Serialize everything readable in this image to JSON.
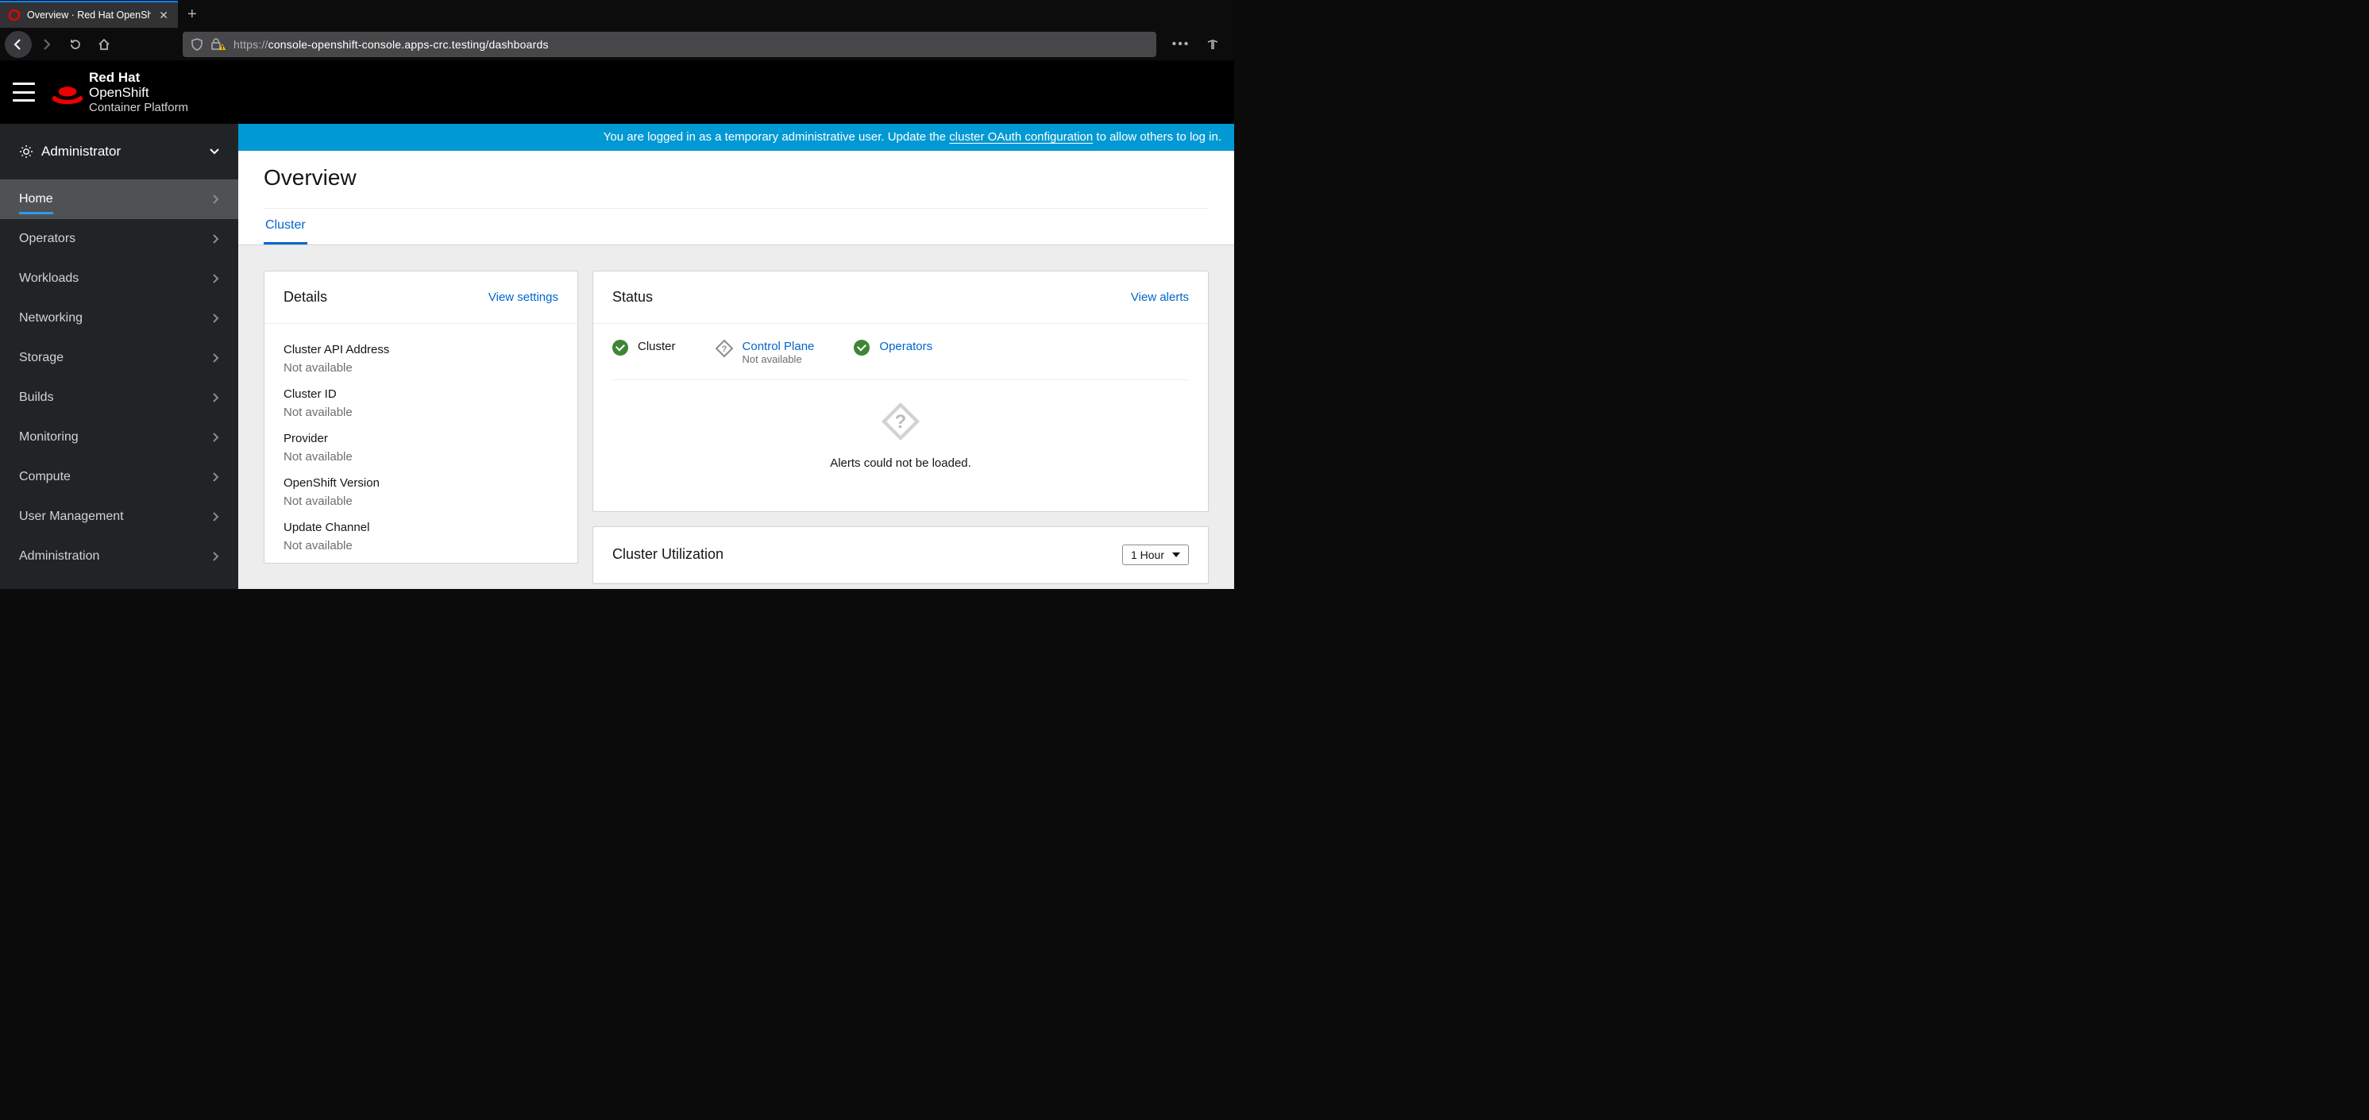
{
  "browser": {
    "tab_title": "Overview · Red Hat OpenShift C",
    "url_scheme": "https://",
    "url_rest": "console-openshift-console.apps-crc.testing/dashboards"
  },
  "masthead": {
    "brand_line1_bold": "Red Hat",
    "brand_line1b": "OpenShift",
    "brand_line2": "Container Platform"
  },
  "sidebar": {
    "perspective": "Administrator",
    "items": [
      {
        "label": "Home",
        "active": true
      },
      {
        "label": "Operators"
      },
      {
        "label": "Workloads"
      },
      {
        "label": "Networking"
      },
      {
        "label": "Storage"
      },
      {
        "label": "Builds"
      },
      {
        "label": "Monitoring"
      },
      {
        "label": "Compute"
      },
      {
        "label": "User Management"
      },
      {
        "label": "Administration"
      }
    ]
  },
  "banner": {
    "prefix": "You are logged in as a temporary administrative user. Update the ",
    "link": "cluster OAuth configuration",
    "suffix": " to allow others to log in."
  },
  "page": {
    "title": "Overview",
    "tab": "Cluster"
  },
  "details": {
    "title": "Details",
    "action": "View settings",
    "items": [
      {
        "k": "Cluster API Address",
        "v": "Not available"
      },
      {
        "k": "Cluster ID",
        "v": "Not available"
      },
      {
        "k": "Provider",
        "v": "Not available"
      },
      {
        "k": "OpenShift Version",
        "v": "Not available"
      },
      {
        "k": "Update Channel",
        "v": "Not available"
      }
    ]
  },
  "status": {
    "title": "Status",
    "action": "View alerts",
    "items": [
      {
        "name": "Cluster",
        "state": "ok",
        "link": false
      },
      {
        "name": "Control Plane",
        "sub": "Not available",
        "state": "unknown",
        "link": true
      },
      {
        "name": "Operators",
        "state": "ok",
        "link": true
      }
    ],
    "alerts_empty": "Alerts could not be loaded."
  },
  "utilization": {
    "title": "Cluster Utilization",
    "range": "1 Hour"
  }
}
